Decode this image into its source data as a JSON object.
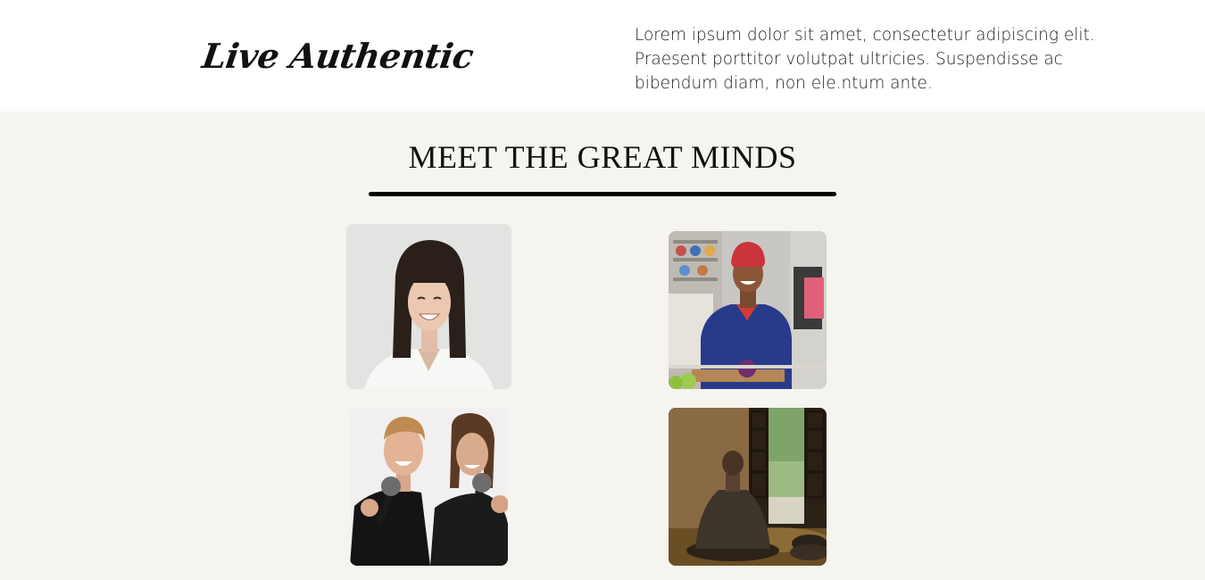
{
  "header": {
    "logo_text": "Live Authentic",
    "tagline": "Lorem ipsum dolor sit amet, consectetur adipiscing elit. Praesent porttitor volutpat ultricies. Suspendisse ac bibendum diam, non ele.ntum ante."
  },
  "section": {
    "title": "MEET THE GREAT MINDS",
    "background": "#f5f4ee"
  },
  "photos": [
    {
      "name": "photo-smiling-woman-dark-bob"
    },
    {
      "name": "photo-chef-in-kitchen"
    },
    {
      "name": "photo-two-men-with-microphones"
    },
    {
      "name": "photo-monk-meditating-by-window"
    }
  ]
}
